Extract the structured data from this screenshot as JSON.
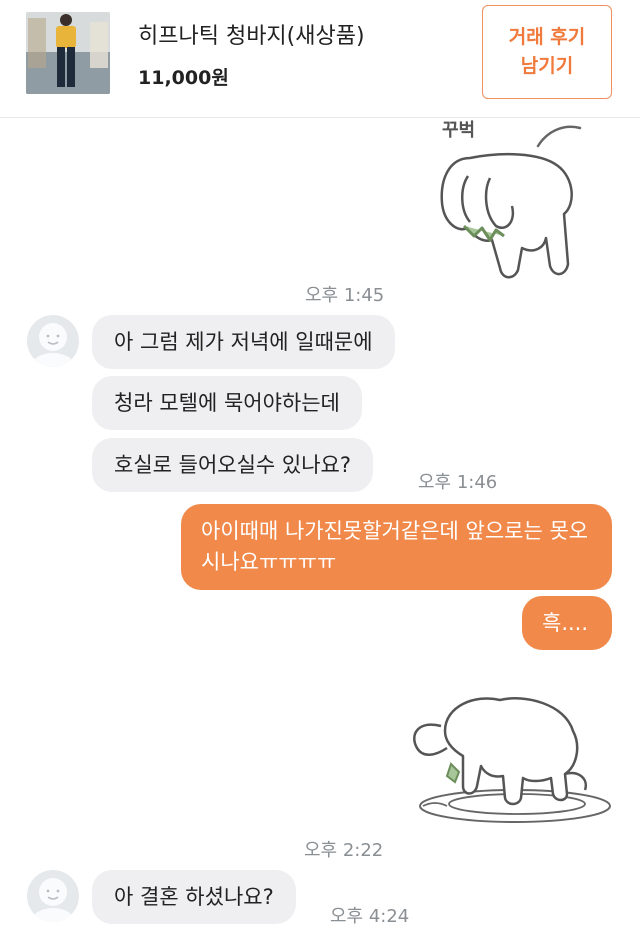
{
  "product": {
    "title": "히프나틱 청바지(새상품)",
    "price": "11,000원",
    "review_button": "거래 후기\n남기기"
  },
  "messages": [
    {
      "type": "sticker",
      "side": "out",
      "caption": "꾸벅",
      "icon": "bowing-bunny-sticker",
      "time": "오후 1:45"
    },
    {
      "type": "text",
      "side": "in",
      "text": "아 그럼 제가 저녁에 일때문에"
    },
    {
      "type": "text",
      "side": "in",
      "text": "청라 모텔에 묵어야하는데"
    },
    {
      "type": "text",
      "side": "in",
      "text": "호실로 들어오실수 있나요?",
      "time": "오후 1:46"
    },
    {
      "type": "text",
      "side": "out",
      "text": "아이때매 나가진못할거같은데 앞으로는 못오시나요ㅠㅠㅠㅠ"
    },
    {
      "type": "text",
      "side": "out",
      "text": "흑...."
    },
    {
      "type": "sticker",
      "side": "out",
      "icon": "crying-bunny-sticker",
      "time": "오후 2:22"
    },
    {
      "type": "text",
      "side": "in",
      "text": "아 결혼 하셨나요?",
      "time": "오후 4:24"
    }
  ],
  "colors": {
    "accent": "#f0894a",
    "incoming_bubble": "#efeff1",
    "time_text": "#8a8f94"
  }
}
